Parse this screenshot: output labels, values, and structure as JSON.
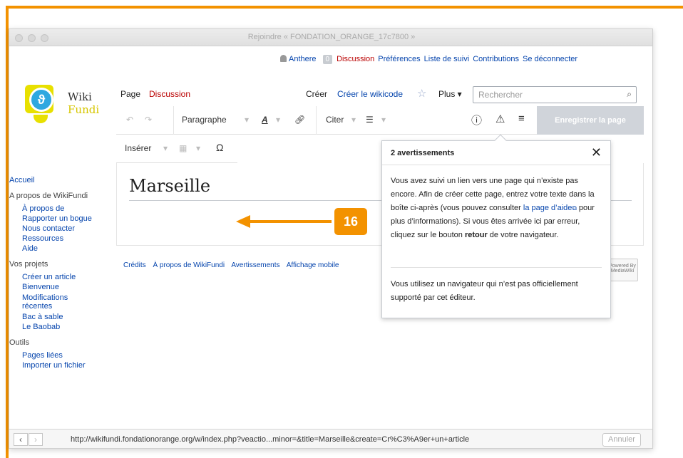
{
  "window": {
    "title": "Rejoindre « FONDATION_ORANGE_17c7800 »"
  },
  "personal": {
    "user": "Anthere",
    "notifications": "0",
    "discussion": "Discussion",
    "preferences": "Préférences",
    "watchlist": "Liste de suivi",
    "contributions": "Contributions",
    "logout": "Se déconnecter"
  },
  "logo": {
    "line1": "Wiki",
    "line2": "Fundi"
  },
  "sidebar": {
    "home": "Accueil",
    "about_head": "A propos de WikiFundi",
    "about_items": [
      "À propos de",
      "Rapporter un bogue",
      "Nous contacter",
      "Ressources",
      "Aide"
    ],
    "projects_head": "Vos projets",
    "project_items": [
      "Créer un article",
      "Bienvenue",
      "Modifications récentes",
      "Bac à sable",
      "Le Baobab"
    ],
    "tools_head": "Outils",
    "tool_items": [
      "Pages liées",
      "Importer un fichier"
    ]
  },
  "tabs": {
    "page": "Page",
    "discussion": "Discussion",
    "create": "Créer",
    "create_wikicode": "Créer le wikicode",
    "more": "Plus ▾",
    "search_placeholder": "Rechercher"
  },
  "toolbar": {
    "paragraph": "Paragraphe",
    "cite": "Citer",
    "insert": "Insérer",
    "save": "Enregistrer la page"
  },
  "page": {
    "heading": "Marseille"
  },
  "footer": {
    "links": [
      "Crédits",
      "À propos de WikiFundi",
      "Avertissements",
      "Affichage mobile"
    ],
    "powered": "Powered By MediaWiki"
  },
  "popup": {
    "title": "2 avertissements",
    "p1_a": "Vous avez suivi un lien vers une page qui n’existe pas encore. Afin de créer cette page, entrez votre texte dans la boîte ci-après (vous pouvez consulter ",
    "p1_link": "la page d’aide",
    "p1_b": " pour plus d’informations). Si vous êtes arrivée ici par erreur, cliquez sur le bouton ",
    "p1_bold": "retour",
    "p1_c": " de votre navigateur.",
    "p2": "Vous utilisez un navigateur qui n’est pas officiellement supporté par cet éditeur."
  },
  "annotation": {
    "step": "16"
  },
  "statusbar": {
    "url": "http://wikifundi.fondationorange.org/w/index.php?veactio...minor=&title=Marseille&create=Cr%C3%A9er+un+article",
    "cancel": "Annuler"
  },
  "colors": {
    "annotation": "#f39200",
    "link": "#0645ad",
    "red_link": "#ba0000"
  }
}
